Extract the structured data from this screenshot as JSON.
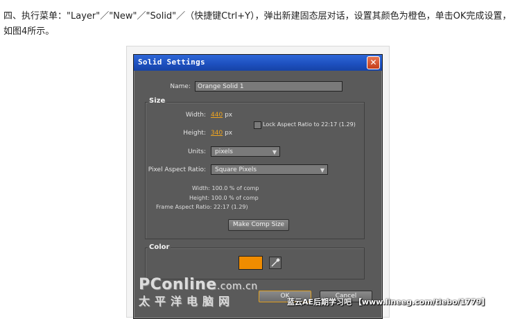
{
  "intro": {
    "text": "四、执行菜单：\"Layer\"／\"New\"／\"Solid\"／（快捷键Ctrl+Y），弹出新建固态层对话，设置其颜色为橙色，单击OK完成设置，如图4所示。"
  },
  "dialog": {
    "title": "Solid Settings",
    "close_glyph": "✕",
    "name_label": "Name:",
    "name_value": "Orange Solid 1",
    "size": {
      "title": "Size",
      "width_label": "Width:",
      "width_value": "440",
      "width_unit": "px",
      "height_label": "Height:",
      "height_value": "340",
      "height_unit": "px",
      "lock_label": "Lock Aspect Ratio to 22:17 (1.29)",
      "units_label": "Units:",
      "units_value": "pixels",
      "par_label": "Pixel Aspect Ratio:",
      "par_value": "Square Pixels",
      "info_width": "Width: 100.0 % of comp",
      "info_height": "Height: 100.0 % of comp",
      "info_far": "Frame Aspect Ratio: 22:17 (1.29)",
      "make_comp_size": "Make Comp Size"
    },
    "color": {
      "title": "Color",
      "swatch_hex": "#f08c00"
    },
    "ok_label": "OK",
    "cancel_label": "Cancel"
  },
  "watermarks": {
    "pconline": "PConline",
    "pconline_suffix": ".com.cn",
    "pconline_cn": "太平洋电脑网",
    "right": "蓝云AE后期学习吧 【www.lineeg.com/tiebo/1779】"
  }
}
